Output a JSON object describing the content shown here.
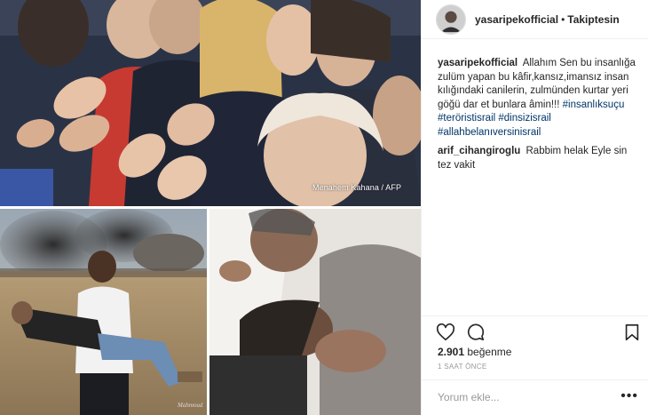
{
  "post": {
    "username": "yasaripekofficial",
    "separator": "•",
    "follow_status": "Takiptesin",
    "photo_credit": "Menahem Kahana / AFP",
    "photo_signature": "Mahmoud"
  },
  "caption": {
    "username": "yasaripekofficial",
    "text": "Allahım Sen bu insanlığa zulüm yapan bu kâfir,kansız,imansız insan kılığındaki canilerin, zulmünden kurtar yeri göğü dar et bunlara âmin!!!",
    "hashtags": [
      "#insanlıksuçu",
      "#teröristisrail",
      "#dinsizisrail",
      "#allahbelanıversinisrail"
    ]
  },
  "comments": [
    {
      "username": "arif_cihangiroglu",
      "text": "Rabbim helak Eyle sin tez vakit"
    }
  ],
  "actions": {
    "like_icon": "heart-icon",
    "comment_icon": "comment-bubble-icon",
    "save_icon": "bookmark-icon"
  },
  "likes_count": "2.901",
  "likes_label": "beğenme",
  "time_ago": "1 SAAT ÖNCE",
  "add_comment": {
    "placeholder": "Yorum ekle...",
    "more_icon": "more-dots-icon",
    "more_label": "•••"
  },
  "colors": {
    "hashtag": "#003569",
    "border": "#efefef",
    "muted": "#999999",
    "text": "#262626"
  }
}
